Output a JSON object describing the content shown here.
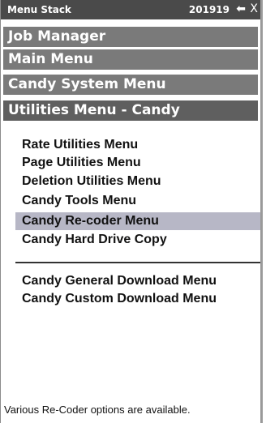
{
  "window": {
    "title": "Menu Stack",
    "code": "201919",
    "back_icon": "left-arrow-icon",
    "close_label": "X"
  },
  "stack": [
    {
      "label": "Job Manager"
    },
    {
      "label": "Main Menu"
    },
    {
      "label": "Candy System Menu"
    },
    {
      "label": "Utilities Menu - Candy"
    }
  ],
  "menu": {
    "items": [
      {
        "label": "Rate Utilities Menu"
      },
      {
        "label": "Page Utilities Menu"
      },
      {
        "label": "Deletion Utilities Menu"
      },
      {
        "label": "Candy Tools Menu"
      },
      {
        "label": "Candy Re-coder Menu",
        "selected": true
      },
      {
        "label": "Candy Hard Drive Copy"
      }
    ],
    "downloads": [
      {
        "label": "Candy General Download Menu"
      },
      {
        "label": "Candy Custom Download Menu"
      }
    ]
  },
  "status": {
    "text": "Various Re-Coder options are available."
  }
}
